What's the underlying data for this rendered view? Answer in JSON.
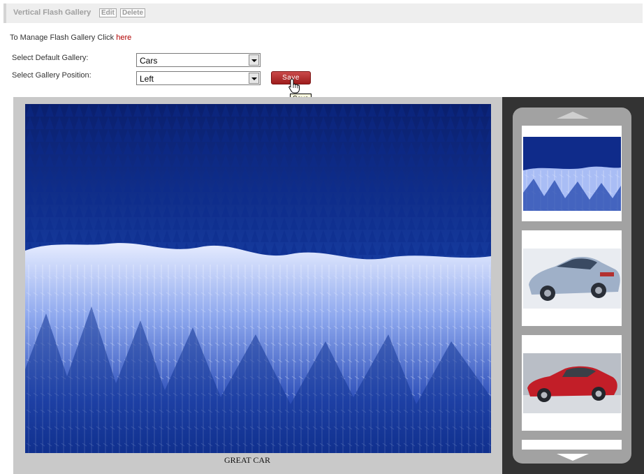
{
  "header": {
    "title": "Vertical Flash Gallery",
    "edit_label": "Edit",
    "delete_label": "Delete"
  },
  "manage": {
    "text": "To Manage Flash Gallery Click ",
    "link_label": "here"
  },
  "form": {
    "default_gallery_label": "Select Default Gallery:",
    "default_gallery_value": "Cars",
    "position_label": "Select Gallery Position:",
    "position_value": "Left",
    "save_label": "Save",
    "save_tooltip": "Save"
  },
  "gallery": {
    "caption": "GREAT CAR",
    "thumbnails": [
      {
        "name": "winter-forest"
      },
      {
        "name": "silver-car"
      },
      {
        "name": "red-car"
      }
    ]
  },
  "colors": {
    "save_button": "#b02a2a",
    "link": "#b00000",
    "panel": "#333333",
    "rail": "#a2a2a2"
  }
}
